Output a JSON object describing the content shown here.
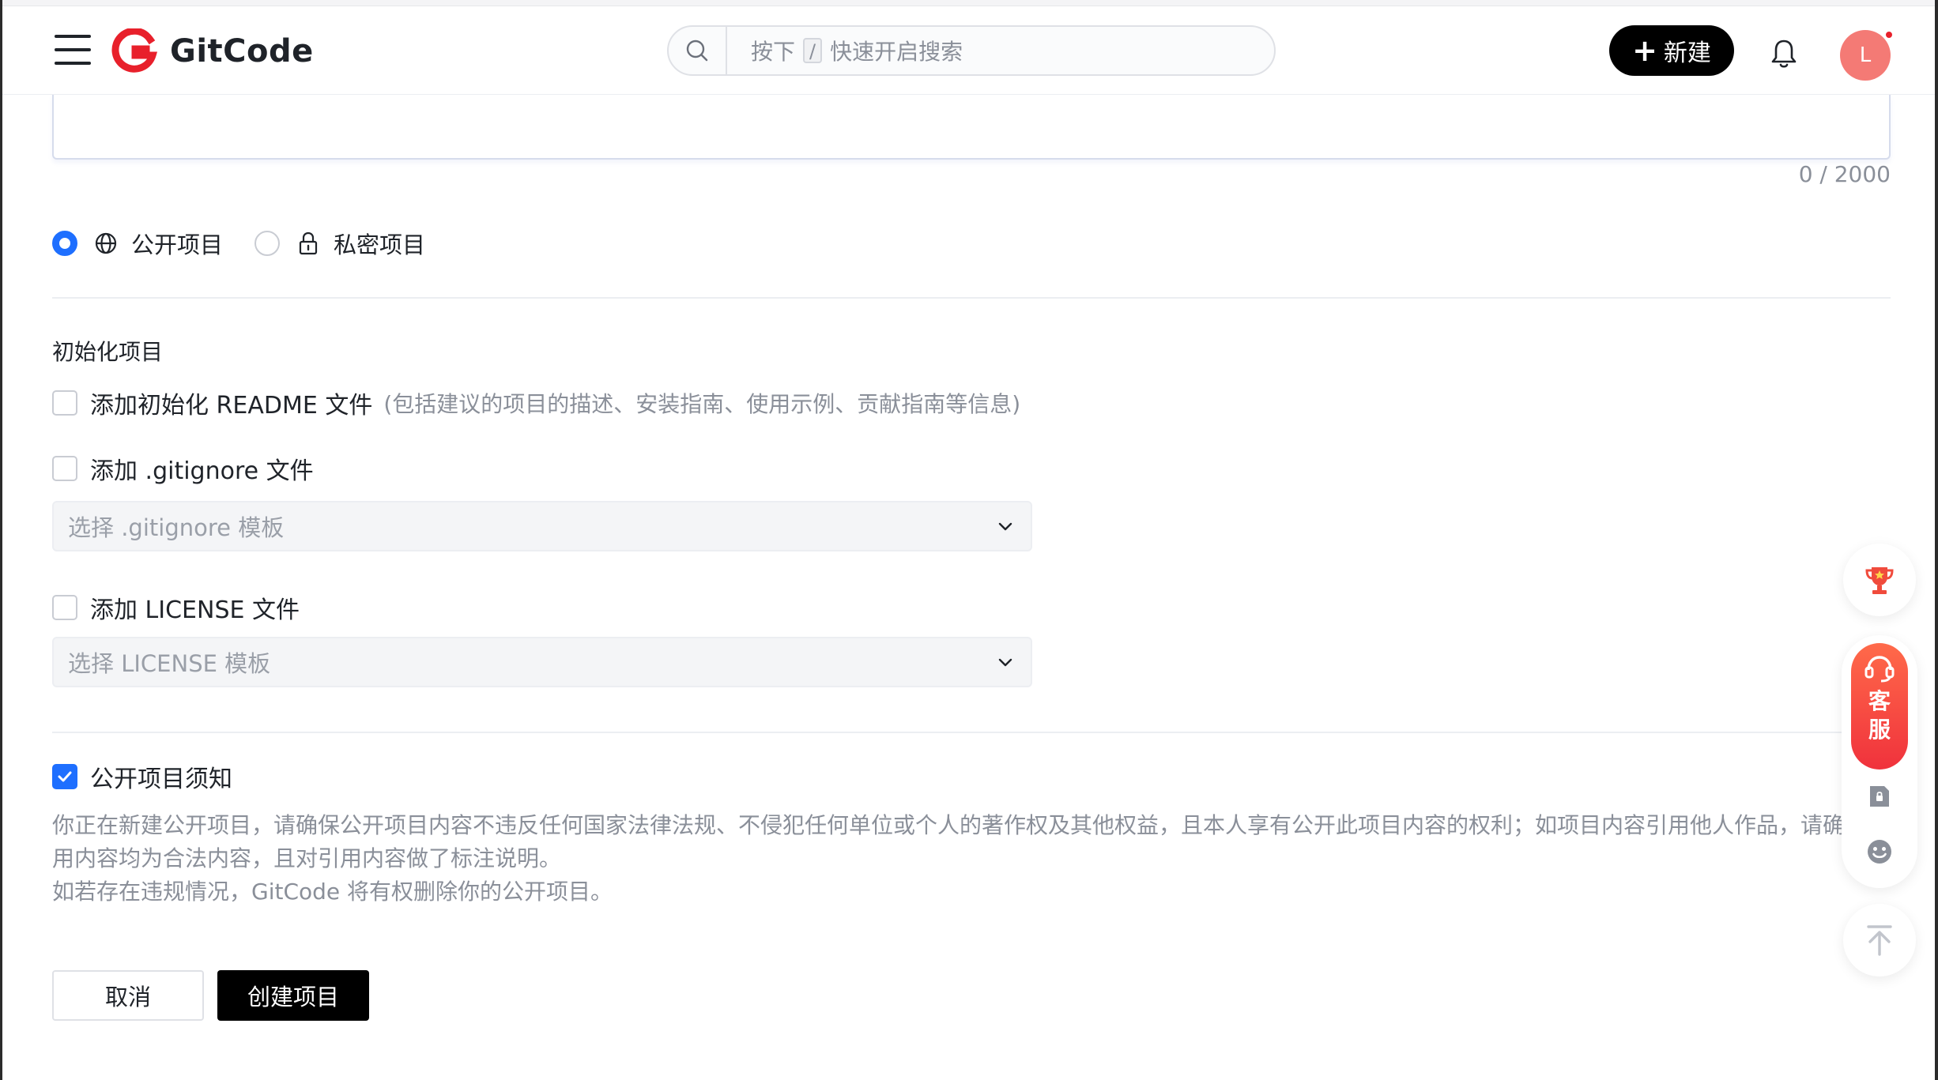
{
  "header": {
    "logo_text": "GitCode",
    "search": {
      "prefix": "按下",
      "key": "/",
      "suffix": "快速开启搜索"
    },
    "new_button_label": "新建",
    "avatar_letter": "L"
  },
  "description": {
    "counter": "0 / 2000"
  },
  "visibility": {
    "public_label": "公开项目",
    "private_label": "私密项目",
    "selected": "public"
  },
  "init": {
    "title": "初始化项目",
    "readme_label": "添加初始化 README 文件",
    "readme_hint": "(包括建议的项目的描述、安装指南、使用示例、贡献指南等信息)",
    "gitignore_label": "添加 .gitignore 文件",
    "gitignore_placeholder": "选择 .gitignore 模板",
    "license_label": "添加 LICENSE 文件",
    "license_placeholder": "选择 LICENSE 模板"
  },
  "notice": {
    "label": "公开项目须知",
    "checked": true,
    "line1": "你正在新建公开项目，请确保公开项目内容不违反任何国家法律法规、不侵犯任何单位或个人的著作权及其他权益，且本人享有公开此项目内容的权利；如项目内容引用他人作品，请确",
    "line2": "用内容均为合法内容，且对引用内容做了标注说明。",
    "line3": "如若存在违规情况，GitCode 将有权删除你的公开项目。"
  },
  "actions": {
    "cancel_label": "取消",
    "create_label": "创建项目"
  },
  "side": {
    "service_label_1": "客",
    "service_label_2": "服"
  },
  "colors": {
    "accent": "#1e6fff",
    "brand_red": "#e8202b",
    "primary_button": "#000000"
  }
}
